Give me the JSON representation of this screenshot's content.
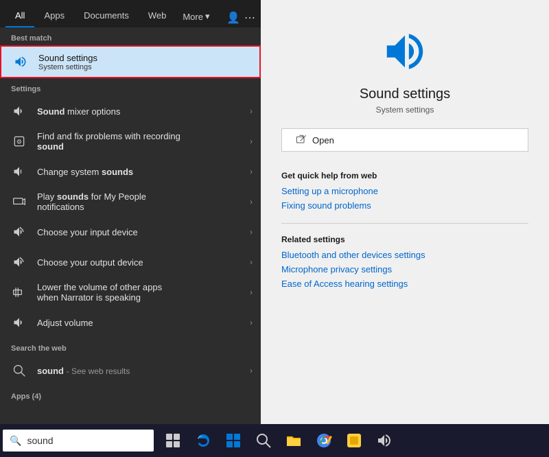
{
  "tabs": {
    "items": [
      {
        "label": "All",
        "active": true
      },
      {
        "label": "Apps",
        "active": false
      },
      {
        "label": "Documents",
        "active": false
      },
      {
        "label": "Web",
        "active": false
      },
      {
        "label": "More ▾",
        "active": false
      }
    ]
  },
  "results": {
    "best_match_label": "Best match",
    "best_match": {
      "title": "Sound settings",
      "subtitle": "System settings"
    },
    "settings_label": "Settings",
    "settings_items": [
      {
        "icon": "speaker",
        "text": "Sound mixer options",
        "bold_word": "Sound",
        "has_chevron": true
      },
      {
        "icon": "mic-fix",
        "text": "Find and fix problems with recording sound",
        "bold_word": "",
        "has_chevron": true
      },
      {
        "icon": "speaker-low",
        "text": "Change system sounds",
        "bold_word": "sounds",
        "has_chevron": true
      },
      {
        "icon": "people",
        "text": "Play sounds for My People notifications",
        "bold_word": "sounds",
        "has_chevron": true
      },
      {
        "icon": "speaker",
        "text": "Choose your input device",
        "bold_word": "",
        "has_chevron": true
      },
      {
        "icon": "speaker",
        "text": "Choose your output device",
        "bold_word": "",
        "has_chevron": true
      },
      {
        "icon": "volume-lower",
        "text": "Lower the volume of other apps when Narrator is speaking",
        "bold_word": "",
        "has_chevron": true
      },
      {
        "icon": "speaker",
        "text": "Adjust volume",
        "bold_word": "",
        "has_chevron": true
      }
    ],
    "web_label": "Search the web",
    "web_item": {
      "text": "sound",
      "suffix": "- See web results",
      "has_chevron": true
    },
    "apps_label": "Apps (4)"
  },
  "detail": {
    "title": "Sound settings",
    "subtitle": "System settings",
    "open_label": "Open",
    "quick_help_label": "Get quick help from web",
    "quick_help_links": [
      "Setting up a microphone",
      "Fixing sound problems"
    ],
    "related_label": "Related settings",
    "related_links": [
      "Bluetooth and other devices settings",
      "Microphone privacy settings",
      "Ease of Access hearing settings"
    ]
  },
  "taskbar": {
    "search_placeholder": "sound",
    "search_text": "sound"
  }
}
